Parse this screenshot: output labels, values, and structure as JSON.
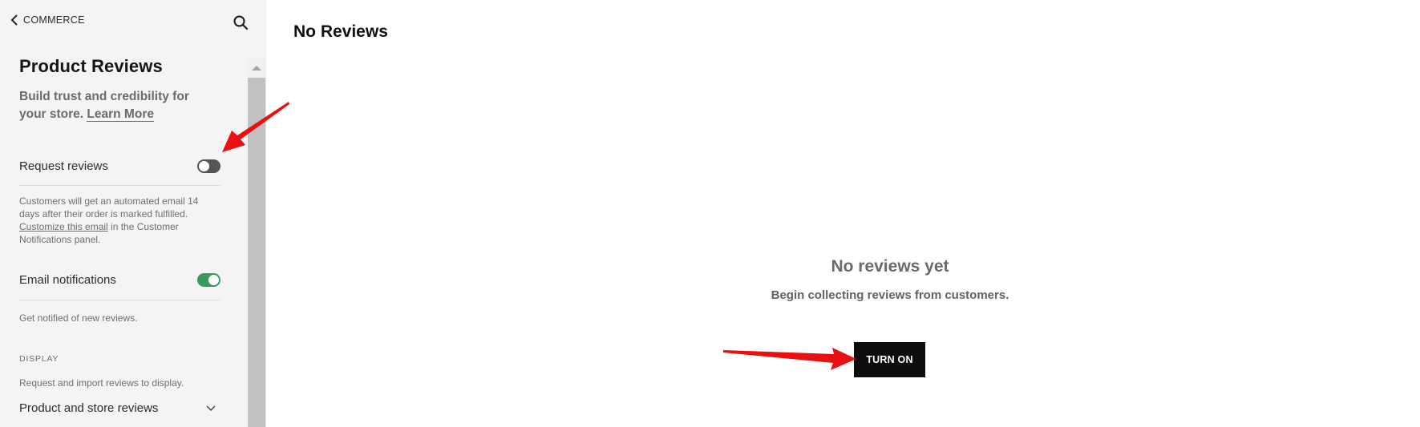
{
  "sidebar": {
    "back_label": "COMMERCE",
    "back_icon": "chevron-left-icon",
    "search_icon": "search-icon",
    "title": "Product Reviews",
    "description_prefix": "Build trust and credibility for your store. ",
    "learn_more": "Learn More",
    "settings": [
      {
        "label": "Request reviews",
        "enabled": false,
        "help_prefix": "Customers will get an automated email 14 days after their order is marked fulfilled. ",
        "help_link": "Customize this email",
        "help_suffix": " in the Customer Notifications panel."
      },
      {
        "label": "Email notifications",
        "enabled": true,
        "help_prefix": "Get notified of new reviews."
      }
    ],
    "display_section": {
      "heading": "DISPLAY",
      "help": "Request and import reviews to display.",
      "dropdown_label": "Product and store reviews",
      "dropdown_icon": "chevron-down-icon"
    }
  },
  "main": {
    "title": "No Reviews",
    "empty_state": {
      "title": "No reviews yet",
      "subtitle": "Begin collecting reviews from customers.",
      "button_label": "TURN ON"
    }
  },
  "colors": {
    "toggle_on": "#3a9a5e",
    "toggle_off": "#555555",
    "button_bg": "#0d0d0d",
    "annotation_arrow": "#e81010"
  }
}
